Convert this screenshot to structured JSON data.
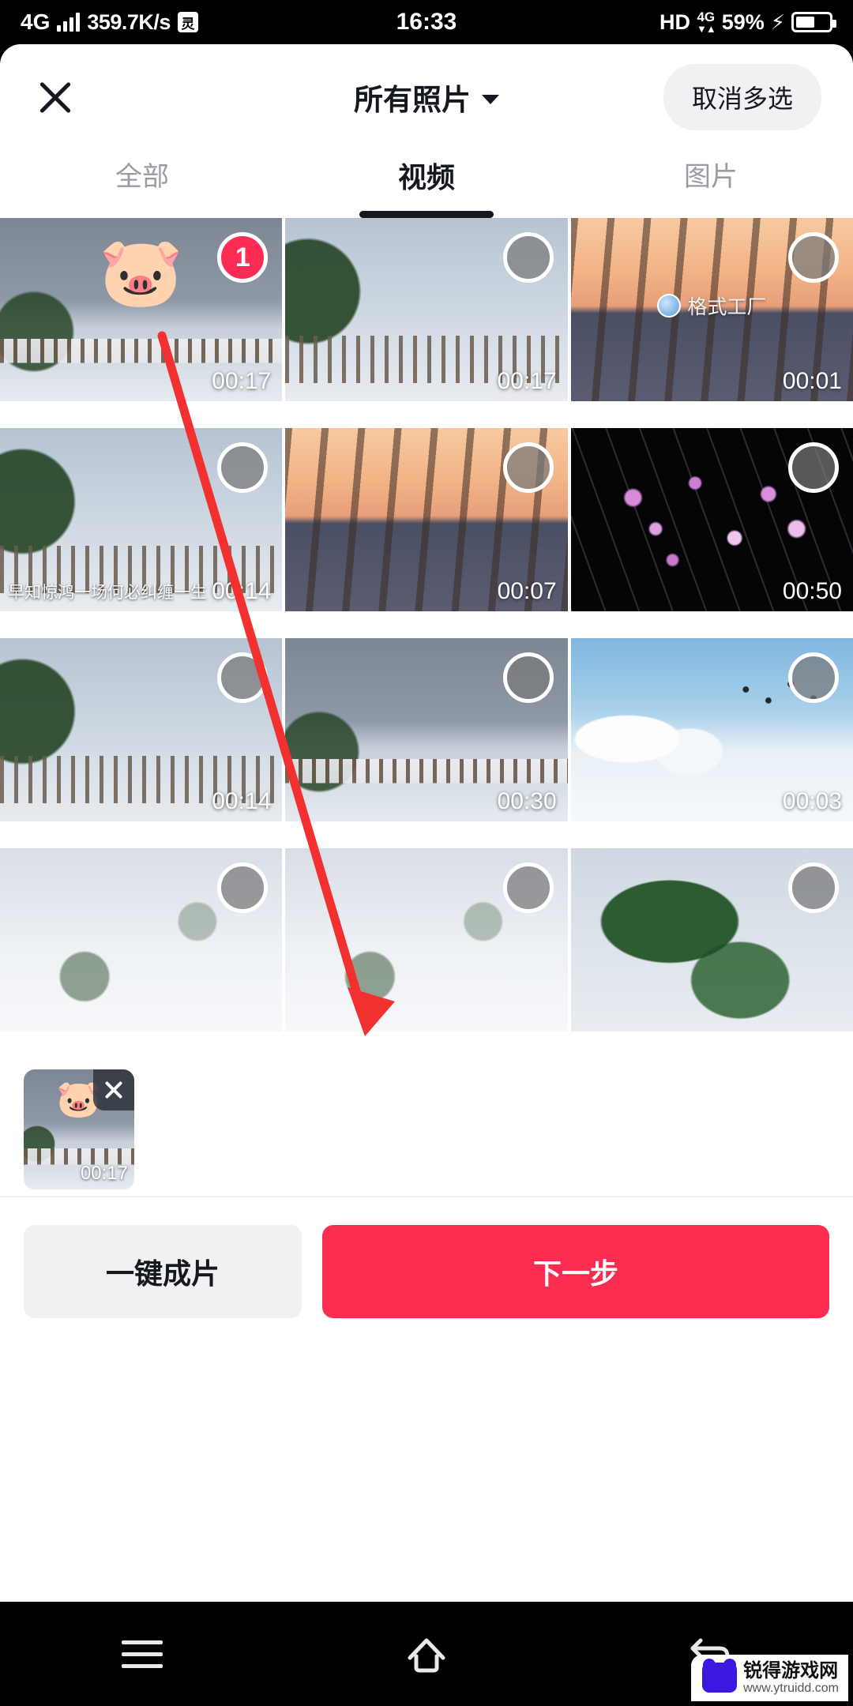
{
  "status_bar": {
    "network_type": "4G",
    "net_speed": "359.7K/s",
    "vpn_badge": "灵",
    "clock": "16:33",
    "hd_label": "HD",
    "volte_label": "4G",
    "battery_percent": "59%",
    "charging": true
  },
  "header": {
    "close_icon": "close-icon",
    "title": "所有照片",
    "dropdown_icon": "chevron-down-icon",
    "cancel_multiselect_label": "取消多选"
  },
  "tabs": [
    {
      "label": "全部",
      "active": false
    },
    {
      "label": "视频",
      "active": true
    },
    {
      "label": "图片",
      "active": false
    }
  ],
  "grid": {
    "items": [
      {
        "duration": "00:17",
        "selected": true,
        "badge": "1",
        "art": "snowdeck",
        "emoji": "🐷",
        "watermark": "",
        "caption": ""
      },
      {
        "duration": "00:17",
        "selected": false,
        "badge": "",
        "art": "snowdeck2",
        "emoji": "",
        "watermark": "",
        "caption": ""
      },
      {
        "duration": "00:01",
        "selected": false,
        "badge": "",
        "art": "sunsettrees",
        "emoji": "",
        "watermark": "格式工厂",
        "caption": ""
      },
      {
        "duration": "00:14",
        "selected": false,
        "badge": "",
        "art": "snowdeck2",
        "emoji": "",
        "watermark": "",
        "caption": "早知惊鸿一场何必纠缠一生"
      },
      {
        "duration": "00:07",
        "selected": false,
        "badge": "",
        "art": "sunsettrees",
        "emoji": "",
        "watermark": "",
        "caption": ""
      },
      {
        "duration": "00:50",
        "selected": false,
        "badge": "",
        "art": "blossom",
        "emoji": "",
        "watermark": "",
        "caption": ""
      },
      {
        "duration": "00:14",
        "selected": false,
        "badge": "",
        "art": "snowdeck2",
        "emoji": "",
        "watermark": "",
        "caption": ""
      },
      {
        "duration": "00:30",
        "selected": false,
        "badge": "",
        "art": "snowdeck",
        "emoji": "",
        "watermark": "",
        "caption": ""
      },
      {
        "duration": "00:03",
        "selected": false,
        "badge": "",
        "art": "birds",
        "emoji": "",
        "watermark": "",
        "caption": ""
      },
      {
        "duration": "",
        "selected": false,
        "badge": "",
        "art": "snowfield",
        "emoji": "",
        "watermark": "",
        "caption": ""
      },
      {
        "duration": "",
        "selected": false,
        "badge": "",
        "art": "snowfield",
        "emoji": "",
        "watermark": "",
        "caption": ""
      },
      {
        "duration": "",
        "selected": false,
        "badge": "",
        "art": "greenleaf",
        "emoji": "",
        "watermark": "",
        "caption": ""
      }
    ]
  },
  "selected_strip": {
    "items": [
      {
        "duration": "00:17",
        "emoji": "🐷",
        "remove_icon": "close-icon"
      }
    ]
  },
  "actions": {
    "secondary_label": "一键成片",
    "primary_label": "下一步",
    "primary_color": "#fa2c4f"
  },
  "nav_bar": {
    "menu_icon": "menu-icon",
    "home_icon": "home-icon",
    "back_icon": "back-icon"
  },
  "annotation": {
    "arrow_color": "#f23030"
  },
  "site_watermark": {
    "name": "锐得游戏网",
    "url": "www.ytruidd.com"
  }
}
